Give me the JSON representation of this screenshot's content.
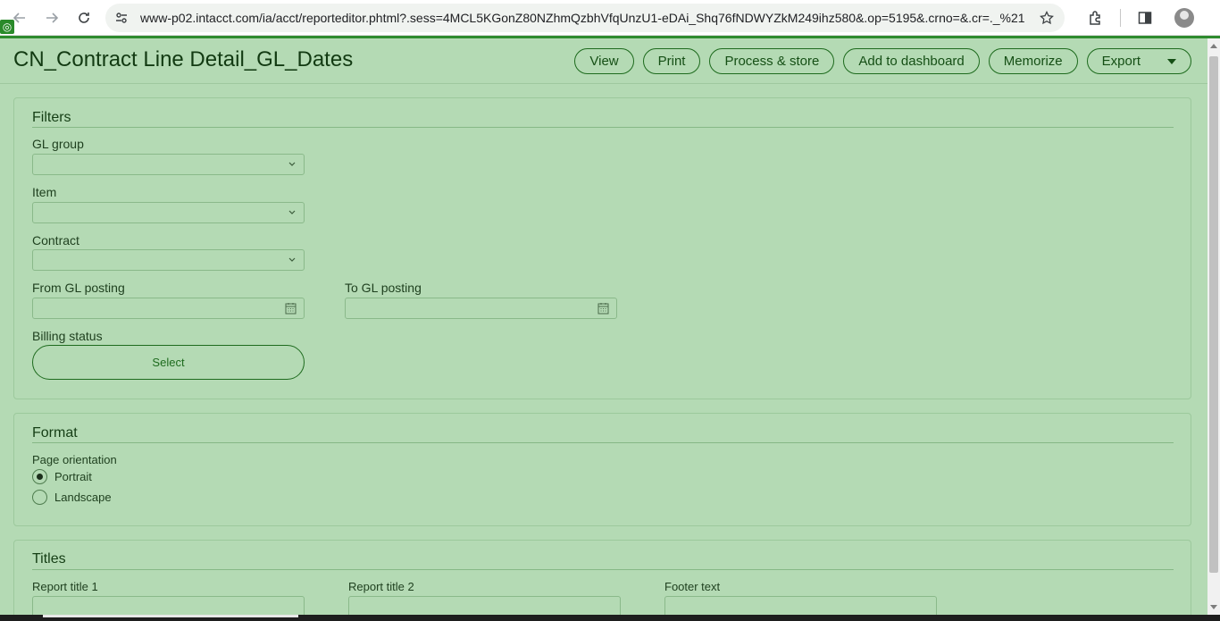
{
  "browser": {
    "url": "www-p02.intacct.com/ia/acct/reporteditor.phtml?.sess=4MCL5KGonZ80NZhmQzbhVfqUnzU1-eDAi_Shq76fNDWYZkM249ihz580&.op=5195&.crno=&.cr=._%21..."
  },
  "header": {
    "title": "CN_Contract Line Detail_GL_Dates",
    "buttons": {
      "view": "View",
      "print": "Print",
      "process": "Process & store",
      "dashboard": "Add to dashboard",
      "memorize": "Memorize",
      "export": "Export"
    }
  },
  "filters": {
    "title": "Filters",
    "gl_group_label": "GL group",
    "item_label": "Item",
    "contract_label": "Contract",
    "from_label": "From GL posting",
    "to_label": "To GL posting",
    "billing_label": "Billing status",
    "billing_button": "Select"
  },
  "format": {
    "title": "Format",
    "orientation_label": "Page orientation",
    "portrait": "Portrait",
    "landscape": "Landscape",
    "selected": "Portrait"
  },
  "titles": {
    "title": "Titles",
    "report_title_1": "Report title 1",
    "report_title_2": "Report title 2",
    "footer_text": "Footer text"
  }
}
